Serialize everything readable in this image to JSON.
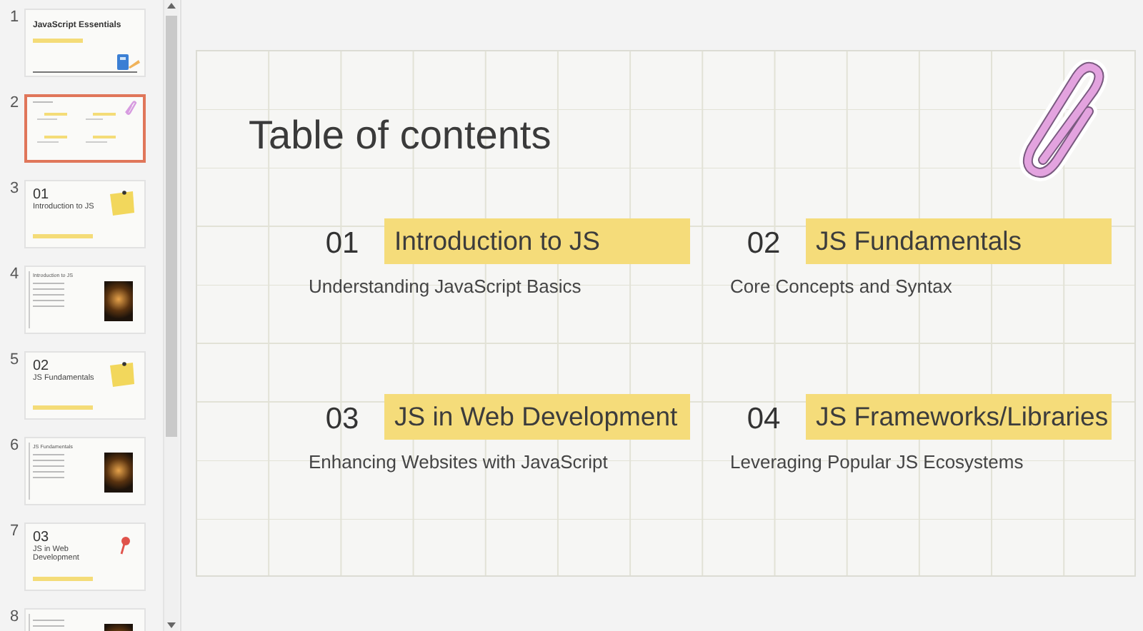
{
  "slides_panel": {
    "thumbnails": [
      {
        "number": "1",
        "selected": false,
        "kind": "title",
        "title": "JavaScript Essentials"
      },
      {
        "number": "2",
        "selected": true,
        "kind": "agenda"
      },
      {
        "number": "3",
        "selected": false,
        "kind": "section",
        "heading": "01",
        "title": "Introduction to JS"
      },
      {
        "number": "4",
        "selected": false,
        "kind": "content",
        "title": "Introduction to JS"
      },
      {
        "number": "5",
        "selected": false,
        "kind": "section",
        "heading": "02",
        "title": "JS Fundamentals"
      },
      {
        "number": "6",
        "selected": false,
        "kind": "content",
        "title": "JS Fundamentals"
      },
      {
        "number": "7",
        "selected": false,
        "kind": "pinsection",
        "heading": "03",
        "title": "JS in Web Development"
      },
      {
        "number": "8",
        "selected": false,
        "kind": "content"
      }
    ]
  },
  "slide": {
    "title": "Table of contents",
    "entries": [
      {
        "number": "01",
        "title": "Introduction to JS",
        "subtitle": "Understanding JavaScript Basics"
      },
      {
        "number": "02",
        "title": "JS Fundamentals",
        "subtitle": "Core Concepts and Syntax"
      },
      {
        "number": "03",
        "title": "JS in Web Development",
        "subtitle": "Enhancing Websites with JavaScript"
      },
      {
        "number": "04",
        "title": "JS Frameworks/Libraries",
        "subtitle": "Leveraging Popular JS Ecosystems"
      }
    ]
  }
}
